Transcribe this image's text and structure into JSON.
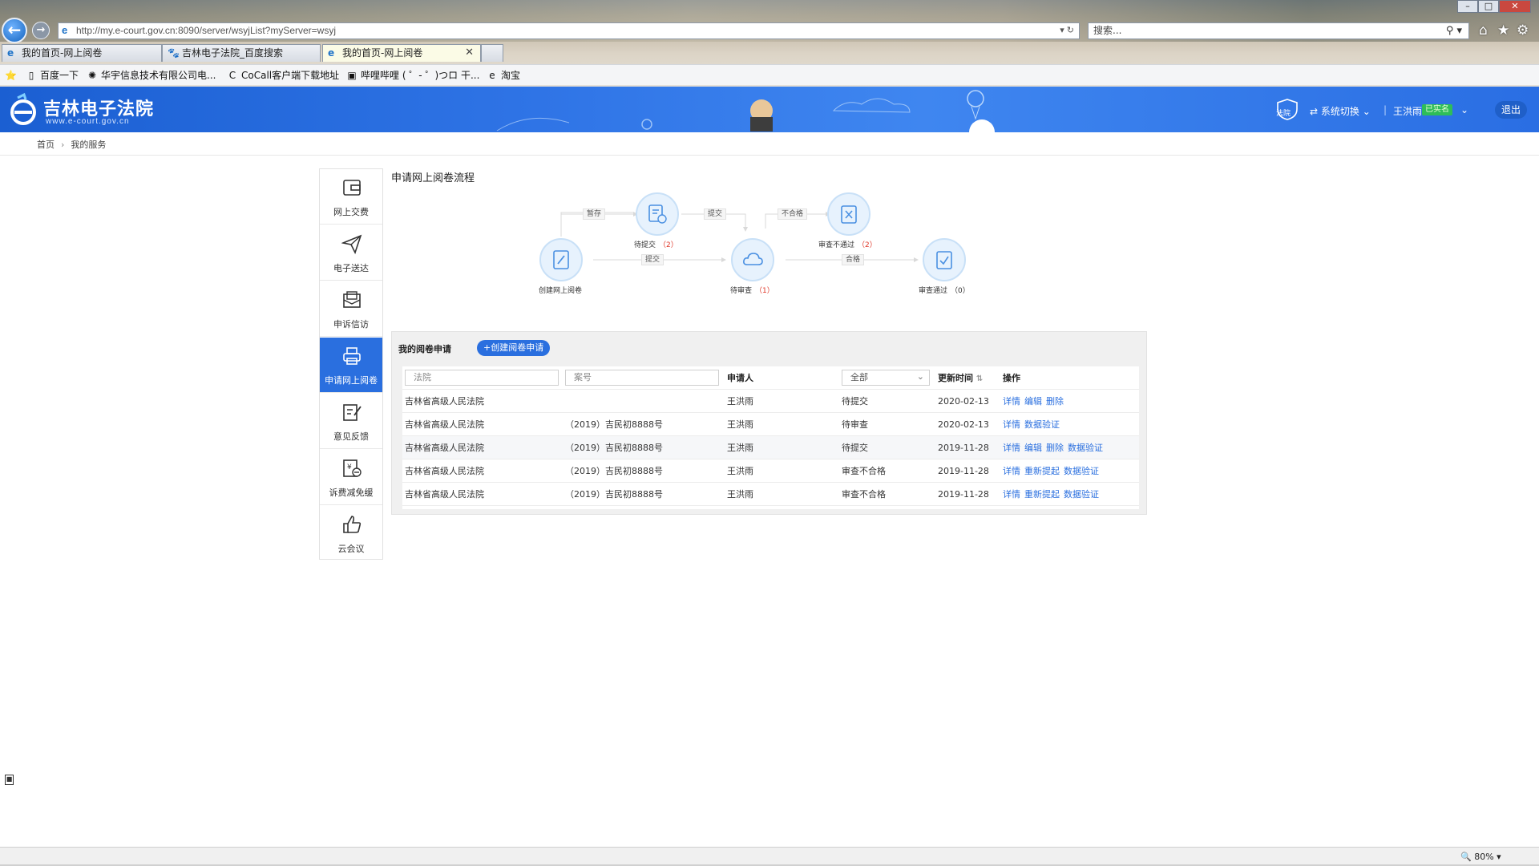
{
  "browser": {
    "url": "http://my.e-court.gov.cn:8090/server/wsyjList?myServer=wsyj",
    "search_placeholder": "搜索...",
    "tabs": [
      {
        "label": "我的首页-网上阅卷"
      },
      {
        "label": "吉林电子法院_百度搜索"
      },
      {
        "label": "我的首页-网上阅卷"
      }
    ],
    "favorites": [
      {
        "label": "百度一下"
      },
      {
        "label": "华宇信息技术有限公司电..."
      },
      {
        "label": "CoCall客户端下载地址"
      },
      {
        "label": "哔哩哔哩 ( ゜- ゜)つロ 干..."
      },
      {
        "label": "淘宝"
      }
    ],
    "zoom": "80%"
  },
  "header": {
    "title": "吉林电子法院",
    "subtitle": "www.e-court.gov.cn",
    "court_icon_label": "法院",
    "system_switch": "系统切换",
    "user_name": "王洪雨",
    "verified": "已实名",
    "logout": "退出"
  },
  "breadcrumb": {
    "home": "首页",
    "current": "我的服务"
  },
  "menu": [
    {
      "label": "网上交费",
      "icon": "wallet-icon"
    },
    {
      "label": "电子送达",
      "icon": "send-icon"
    },
    {
      "label": "申诉信访",
      "icon": "mail-icon"
    },
    {
      "label": "申请网上阅卷",
      "icon": "printer-icon",
      "active": true
    },
    {
      "label": "意见反馈",
      "icon": "edit-icon"
    },
    {
      "label": "诉费减免缓",
      "icon": "fee-icon"
    },
    {
      "label": "云会议",
      "icon": "thumbs-up-icon"
    }
  ],
  "flow": {
    "title": "申请网上阅卷流程",
    "nodes": {
      "create": {
        "label": "创建网上阅卷"
      },
      "pending_submit": {
        "label": "待提交",
        "count": "（2）"
      },
      "pending_review": {
        "label": "待审查",
        "count": "（1）"
      },
      "rejected": {
        "label": "审查不通过",
        "count": "（2）"
      },
      "approved": {
        "label": "审查通过",
        "count": "（0）"
      }
    },
    "edges": {
      "save": "暂存",
      "submit_top": "提交",
      "submit_bottom": "提交",
      "fail": "不合格",
      "pass": "合格"
    }
  },
  "panel": {
    "title": "我的阅卷申请",
    "create_button": "+创建阅卷申请",
    "filters": {
      "court_placeholder": "法院",
      "case_placeholder": "案号",
      "status_selected": "全部"
    },
    "columns": {
      "applicant": "申请人",
      "updated": "更新时间",
      "actions": "操作"
    },
    "rows": [
      {
        "court": "吉林省高级人民法院",
        "case": "",
        "applicant": "王洪雨",
        "status": "待提交",
        "date": "2020-02-13",
        "actions": [
          "详情",
          "编辑",
          "删除"
        ]
      },
      {
        "court": "吉林省高级人民法院",
        "case": "（2019）吉民初8888号",
        "applicant": "王洪雨",
        "status": "待审查",
        "date": "2020-02-13",
        "actions": [
          "详情",
          "数据验证"
        ]
      },
      {
        "court": "吉林省高级人民法院",
        "case": "（2019）吉民初8888号",
        "applicant": "王洪雨",
        "status": "待提交",
        "date": "2019-11-28",
        "actions": [
          "详情",
          "编辑",
          "删除",
          "数据验证"
        ]
      },
      {
        "court": "吉林省高级人民法院",
        "case": "（2019）吉民初8888号",
        "applicant": "王洪雨",
        "status": "审查不合格",
        "date": "2019-11-28",
        "actions": [
          "详情",
          "重新提起",
          "数据验证"
        ]
      },
      {
        "court": "吉林省高级人民法院",
        "case": "（2019）吉民初8888号",
        "applicant": "王洪雨",
        "status": "审查不合格",
        "date": "2019-11-28",
        "actions": [
          "详情",
          "重新提起",
          "数据验证"
        ]
      }
    ]
  },
  "colors": {
    "primary": "#2a6fdf",
    "header_blue": "#2f74e6",
    "count_red": "#e0392b",
    "verified_green": "#2ebd59"
  }
}
